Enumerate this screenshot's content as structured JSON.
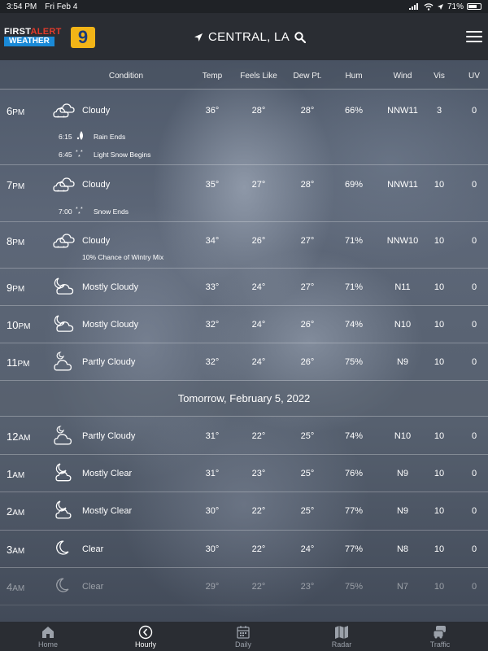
{
  "status_bar": {
    "time": "3:54 PM",
    "date": "Fri Feb 4",
    "battery": "71%",
    "battery_level": 0.71
  },
  "header": {
    "logo_line1_first": "FIRST",
    "logo_line1_alert": "ALERT",
    "logo_line2": "WEATHER",
    "logo_channel": "9",
    "location": "CENTRAL, LA"
  },
  "columns": {
    "condition": "Condition",
    "temp": "Temp",
    "feels_like": "Feels Like",
    "dew_pt": "Dew Pt.",
    "hum": "Hum",
    "wind": "Wind",
    "vis": "Vis",
    "uv": "UV"
  },
  "today_rows": [
    {
      "hour": "6",
      "ampm": "PM",
      "icon": "cloudy-snow-icon",
      "condition": "Cloudy",
      "temp": "36°",
      "feels": "28°",
      "dew": "28°",
      "hum": "66%",
      "wind": "NNW11",
      "vis": "3",
      "uv": "0"
    },
    {
      "hour": "7",
      "ampm": "PM",
      "icon": "cloudy-snow-icon",
      "condition": "Cloudy",
      "temp": "35°",
      "feels": "27°",
      "dew": "28°",
      "hum": "69%",
      "wind": "NNW11",
      "vis": "10",
      "uv": "0"
    },
    {
      "hour": "8",
      "ampm": "PM",
      "icon": "cloudy-snow-icon",
      "condition": "Cloudy",
      "temp": "34°",
      "feels": "26°",
      "dew": "27°",
      "hum": "71%",
      "wind": "NNW10",
      "vis": "10",
      "uv": "0"
    },
    {
      "hour": "9",
      "ampm": "PM",
      "icon": "mostly-cloudy-night-icon",
      "condition": "Mostly Cloudy",
      "temp": "33°",
      "feels": "24°",
      "dew": "27°",
      "hum": "71%",
      "wind": "N11",
      "vis": "10",
      "uv": "0"
    },
    {
      "hour": "10",
      "ampm": "PM",
      "icon": "mostly-cloudy-night-icon",
      "condition": "Mostly Cloudy",
      "temp": "32°",
      "feels": "24°",
      "dew": "26°",
      "hum": "74%",
      "wind": "N10",
      "vis": "10",
      "uv": "0"
    },
    {
      "hour": "11",
      "ampm": "PM",
      "icon": "partly-cloudy-night-icon",
      "condition": "Partly Cloudy",
      "temp": "32°",
      "feels": "24°",
      "dew": "26°",
      "hum": "75%",
      "wind": "N9",
      "vis": "10",
      "uv": "0"
    }
  ],
  "events": {
    "e1_time": "6:15",
    "e1_text": "Rain Ends",
    "e2_time": "6:45",
    "e2_text": "Light Snow Begins",
    "e3_time": "7:00",
    "e3_text": "Snow Ends",
    "e4_text": "10% Chance of Wintry Mix"
  },
  "day_divider": "Tomorrow, February 5, 2022",
  "tomorrow_rows": [
    {
      "hour": "12",
      "ampm": "AM",
      "icon": "partly-cloudy-night-icon",
      "condition": "Partly Cloudy",
      "temp": "31°",
      "feels": "22°",
      "dew": "25°",
      "hum": "74%",
      "wind": "N10",
      "vis": "10",
      "uv": "0"
    },
    {
      "hour": "1",
      "ampm": "AM",
      "icon": "mostly-clear-night-icon",
      "condition": "Mostly Clear",
      "temp": "31°",
      "feels": "23°",
      "dew": "25°",
      "hum": "76%",
      "wind": "N9",
      "vis": "10",
      "uv": "0"
    },
    {
      "hour": "2",
      "ampm": "AM",
      "icon": "mostly-clear-night-icon",
      "condition": "Mostly Clear",
      "temp": "30°",
      "feels": "22°",
      "dew": "25°",
      "hum": "77%",
      "wind": "N9",
      "vis": "10",
      "uv": "0"
    },
    {
      "hour": "3",
      "ampm": "AM",
      "icon": "clear-night-icon",
      "condition": "Clear",
      "temp": "30°",
      "feels": "22°",
      "dew": "24°",
      "hum": "77%",
      "wind": "N8",
      "vis": "10",
      "uv": "0"
    },
    {
      "hour": "4",
      "ampm": "AM",
      "icon": "clear-night-icon",
      "condition": "Clear",
      "temp": "29°",
      "feels": "22°",
      "dew": "23°",
      "hum": "75%",
      "wind": "N7",
      "vis": "10",
      "uv": "0"
    }
  ],
  "tabs": [
    {
      "label": "Home",
      "icon": "home-icon",
      "active": false
    },
    {
      "label": "Hourly",
      "icon": "hourly-icon",
      "active": true
    },
    {
      "label": "Daily",
      "icon": "calendar-icon",
      "active": false
    },
    {
      "label": "Radar",
      "icon": "map-icon",
      "active": false
    },
    {
      "label": "Traffic",
      "icon": "traffic-icon",
      "active": false
    }
  ]
}
